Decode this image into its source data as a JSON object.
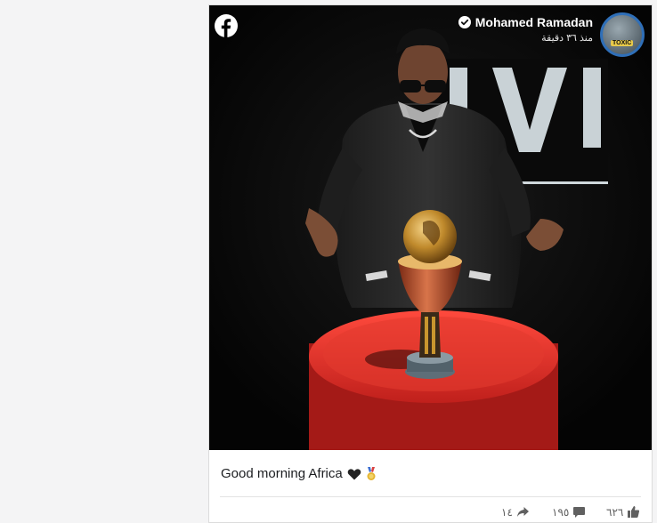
{
  "post": {
    "author": "Mohamed Ramadan",
    "time": "منذ ٣٦ دقيقة",
    "avatar_badge": "TOXIC",
    "caption": "Good morning Africa",
    "caption_emojis": [
      "black-heart-icon",
      "medal-icon"
    ],
    "image_backdrop_text": "IVI"
  },
  "stats": {
    "likes": "٦٢٦",
    "comments": "١٩٥",
    "shares": "١٤"
  },
  "colors": {
    "facebook": "#ffffff",
    "avatar_ring": "#2f6fb8",
    "trophy_gold": "#c9962e",
    "table_red": "#d92a28"
  }
}
